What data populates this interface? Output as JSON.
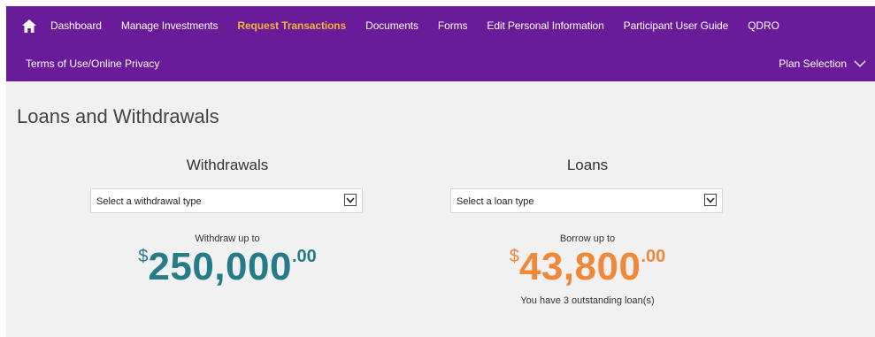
{
  "nav": {
    "items": [
      {
        "label": "Dashboard"
      },
      {
        "label": "Manage Investments"
      },
      {
        "label": "Request Transactions",
        "active": true
      },
      {
        "label": "Documents"
      },
      {
        "label": "Forms"
      },
      {
        "label": "Edit Personal Information"
      },
      {
        "label": "Participant User Guide"
      },
      {
        "label": "QDRO"
      }
    ],
    "terms": "Terms of Use/Online Privacy",
    "plan_selection": "Plan Selection",
    "home_icon": "home-icon",
    "chevron_icon": "chevron-down-icon"
  },
  "page": {
    "title": "Loans and Withdrawals"
  },
  "withdrawals": {
    "heading": "Withdrawals",
    "select_placeholder": "Select a withdrawal type",
    "amount_label": "Withdraw up to",
    "currency": "$",
    "amount": "250,000",
    "cents": ".00",
    "color": "#267b88"
  },
  "loans": {
    "heading": "Loans",
    "select_placeholder": "Select a loan type",
    "amount_label": "Borrow up to",
    "currency": "$",
    "amount": "43,800",
    "cents": ".00",
    "note": "You have 3 outstanding loan(s)",
    "color": "#f0883a"
  },
  "colors": {
    "nav_bg": "#6a1b9a",
    "active_nav": "#f5b335",
    "page_bg": "#f1f1f1"
  }
}
